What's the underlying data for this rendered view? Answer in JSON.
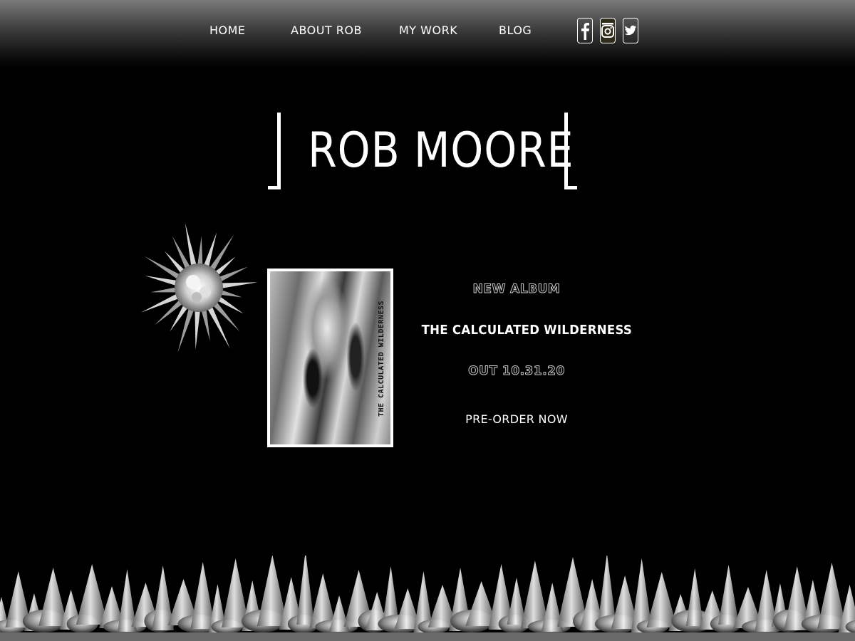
{
  "nav": {
    "items": [
      {
        "label": "HOME"
      },
      {
        "label": "ABOUT ROB"
      },
      {
        "label": "MY WORK"
      },
      {
        "label": "BLOG"
      }
    ],
    "social": [
      "facebook-icon",
      "instagram-icon",
      "twitter-icon"
    ]
  },
  "header": {
    "title": "ROB MOORE"
  },
  "album": {
    "cover_text": "THE CALCULATED WILDERNESS",
    "kicker": "NEW ALBUM",
    "name": "THE CALCULATED WILDERNESS",
    "release": "OUT 10.31.20",
    "cta": "PRE-ORDER NOW"
  },
  "colors": {
    "background": "#000000",
    "text": "#ffffff",
    "outline_text": "#c8c8c8"
  }
}
